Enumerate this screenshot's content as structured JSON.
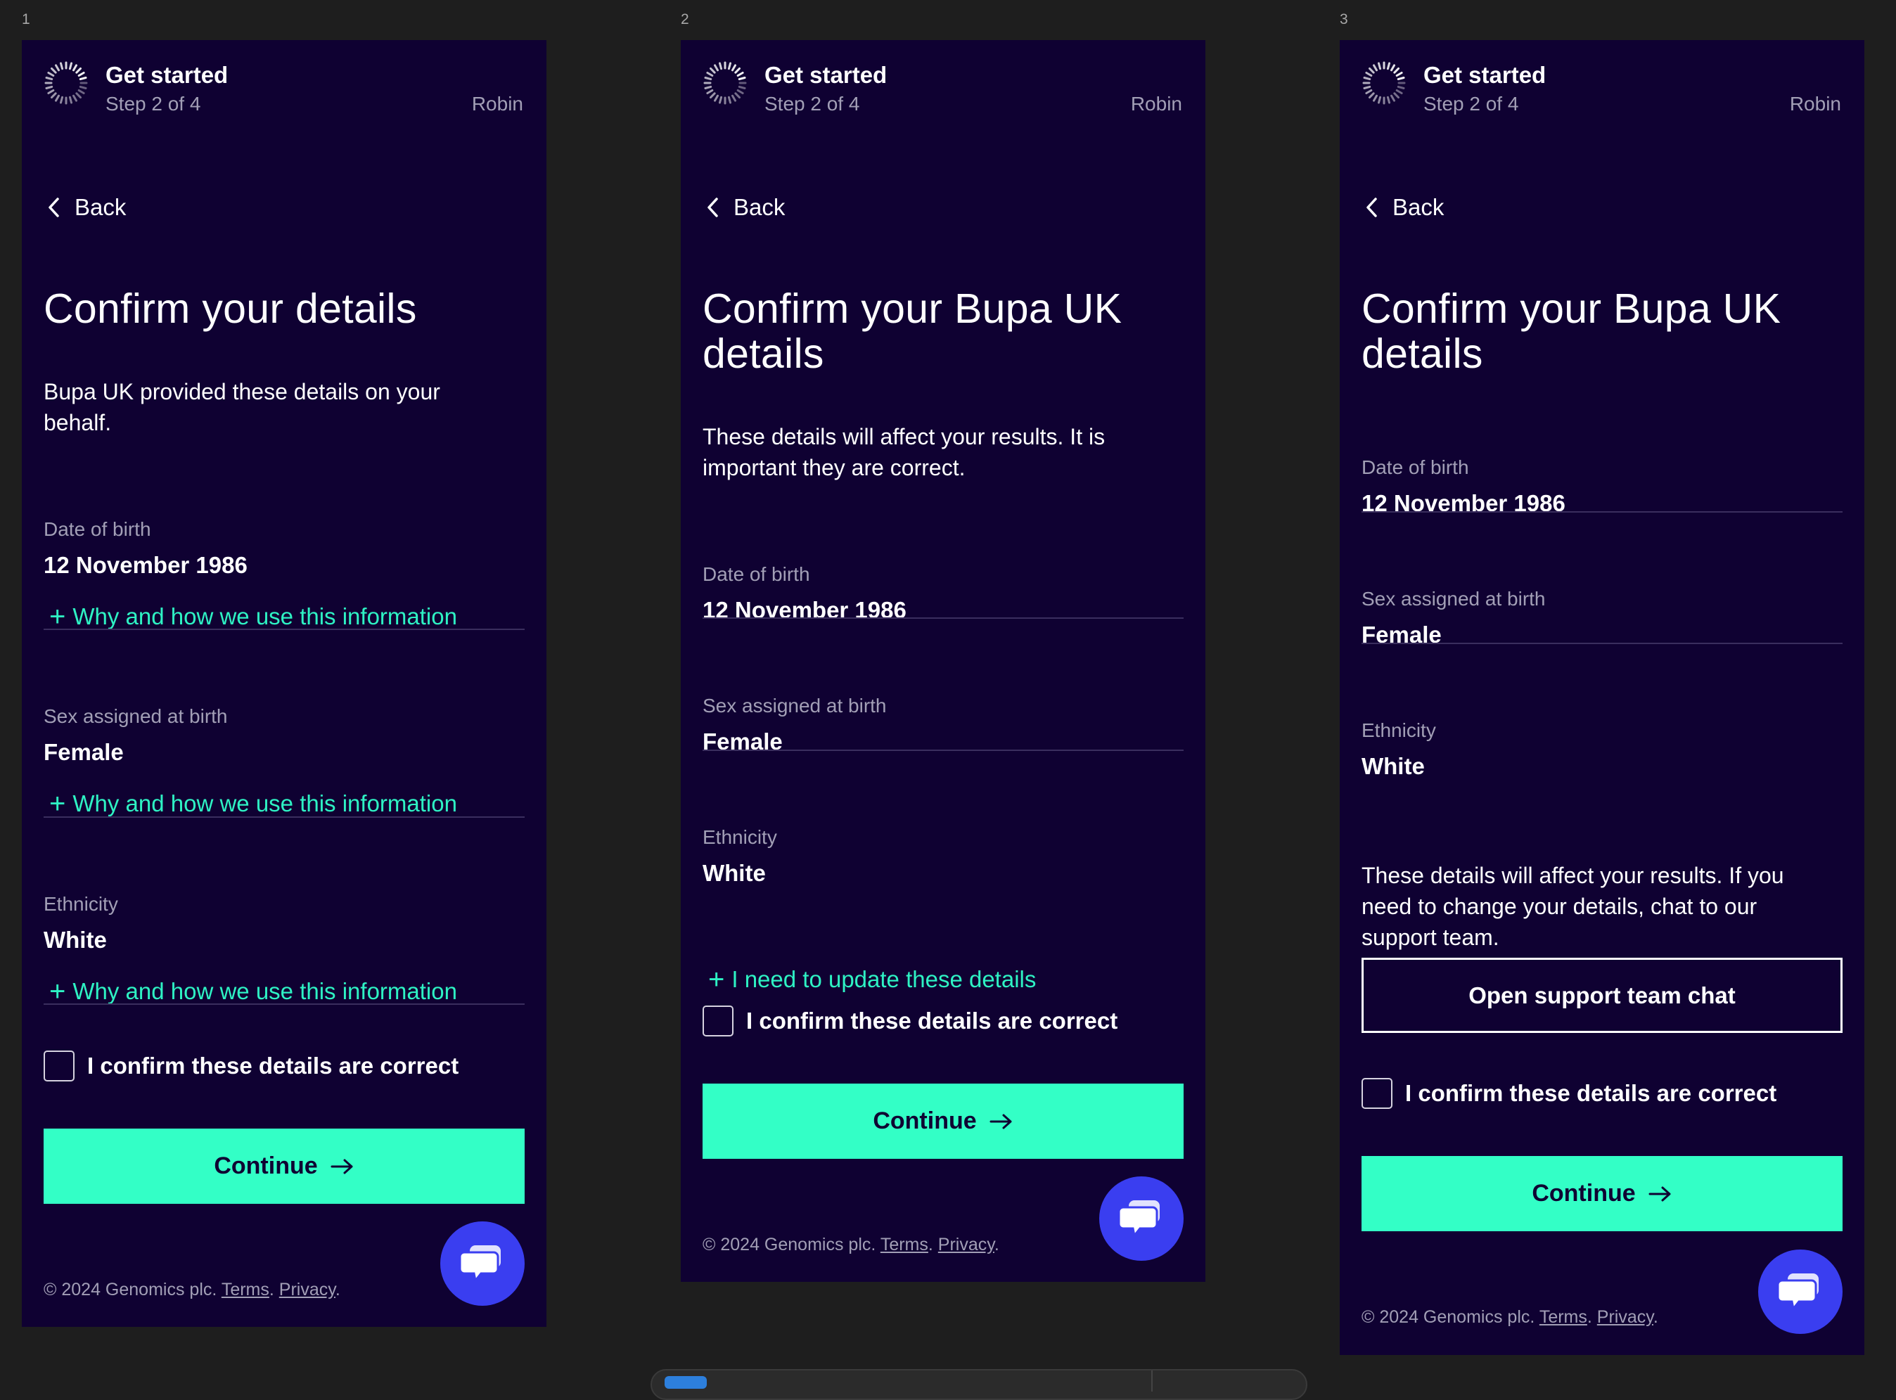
{
  "frames": [
    {
      "number": "1",
      "header": {
        "title": "Get started",
        "step": "Step 2 of 4",
        "user": "Robin"
      },
      "back_label": "Back",
      "title": "Confirm your details",
      "lead": "Bupa UK provided these details on your behalf.",
      "fields": [
        {
          "label": "Date of birth",
          "value": "12 November 1986",
          "why": "Why and how we use this information"
        },
        {
          "label": "Sex assigned at birth",
          "value": "Female",
          "why": "Why and how we use this information"
        },
        {
          "label": "Ethnicity",
          "value": "White",
          "why": "Why and how we use this information"
        }
      ],
      "confirm_label": "I confirm these details are correct",
      "continue_label": "Continue",
      "footer": {
        "copyright": "© 2024 Genomics plc.",
        "terms": "Terms",
        "privacy": "Privacy"
      }
    },
    {
      "number": "2",
      "header": {
        "title": "Get started",
        "step": "Step 2 of 4",
        "user": "Robin"
      },
      "back_label": "Back",
      "title": "Confirm your Bupa UK details",
      "lead": "These details will affect your results. It is important they are correct.",
      "fields": [
        {
          "label": "Date of birth",
          "value": "12 November 1986"
        },
        {
          "label": "Sex assigned at birth",
          "value": "Female"
        },
        {
          "label": "Ethnicity",
          "value": "White"
        }
      ],
      "update_link": "I need to update these details",
      "confirm_label": "I confirm these details are correct",
      "continue_label": "Continue",
      "footer": {
        "copyright": "© 2024 Genomics plc.",
        "terms": "Terms",
        "privacy": "Privacy"
      }
    },
    {
      "number": "3",
      "header": {
        "title": "Get started",
        "step": "Step 2 of 4",
        "user": "Robin"
      },
      "back_label": "Back",
      "title": "Confirm your Bupa UK details",
      "fields": [
        {
          "label": "Date of birth",
          "value": "12 November 1986"
        },
        {
          "label": "Sex assigned at birth",
          "value": "Female"
        },
        {
          "label": "Ethnicity",
          "value": "White"
        }
      ],
      "info": "These details will affect your results. If you need to change your details, chat to our support team.",
      "support_button": "Open support team chat",
      "confirm_label": "I confirm these details are correct",
      "continue_label": "Continue",
      "footer": {
        "copyright": "© 2024 Genomics plc.",
        "terms": "Terms",
        "privacy": "Privacy"
      }
    }
  ],
  "colors": {
    "canvas": "#1e1e1e",
    "frame_bg": "#0f0132",
    "accent": "#33ffc6",
    "link": "#2ef3c4",
    "muted": "#a29fb6",
    "chat_button": "#3a3ef0"
  },
  "icons": [
    "loading-spinner-logo-icon",
    "chevron-left-icon",
    "plus-icon",
    "arrow-right-icon",
    "chat-bubbles-icon"
  ]
}
